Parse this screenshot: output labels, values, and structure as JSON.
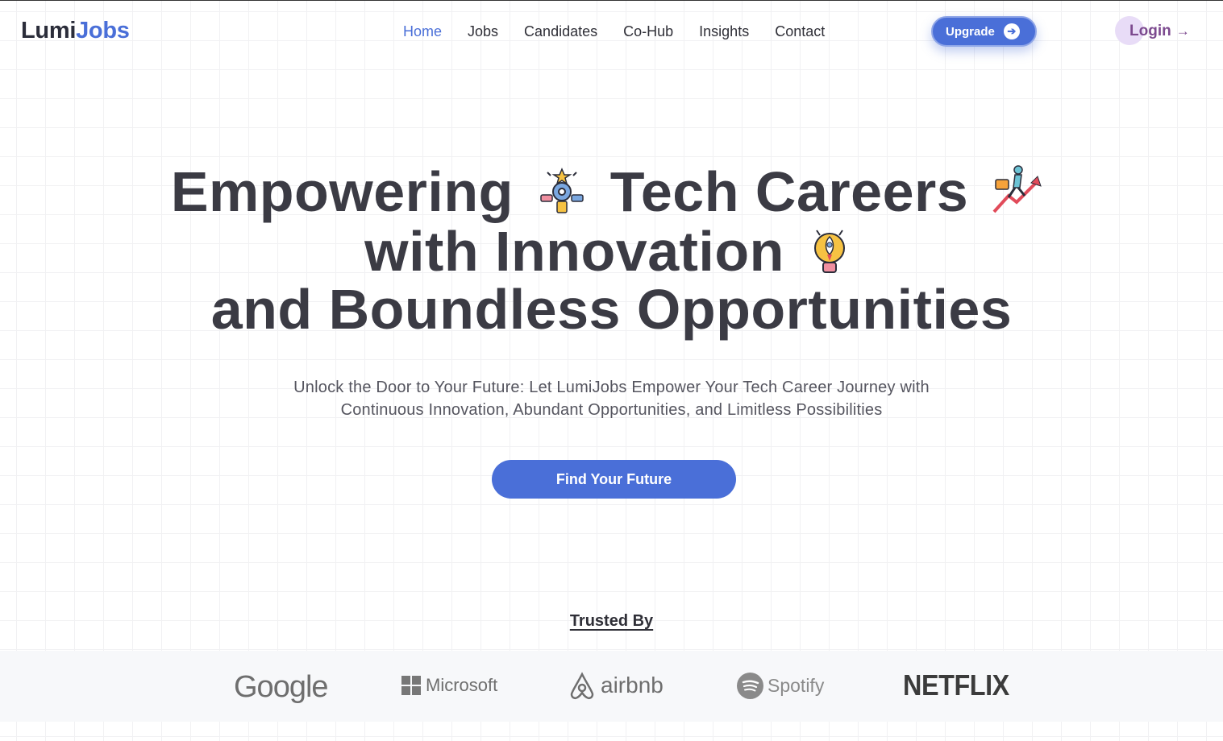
{
  "brand": {
    "part1": "Lumi",
    "part2": "Jobs"
  },
  "nav": {
    "items": [
      {
        "label": "Home",
        "active": true
      },
      {
        "label": "Jobs",
        "active": false
      },
      {
        "label": "Candidates",
        "active": false
      },
      {
        "label": "Co-Hub",
        "active": false
      },
      {
        "label": "Insights",
        "active": false
      },
      {
        "label": "Contact",
        "active": false
      }
    ]
  },
  "header": {
    "upgrade_label": "Upgrade",
    "upgrade_icon": "arrow-right-circle-icon",
    "login_label": "Login",
    "login_arrow": "→"
  },
  "hero": {
    "line1_a": "Empowering",
    "line1_b": "Tech Careers",
    "line2": "with Innovation",
    "line3": "and Boundless Opportunities",
    "emoji_1": "teamwork-gear-icon",
    "emoji_2": "career-growth-runner-icon",
    "emoji_3": "rocket-lightbulb-icon"
  },
  "subtitle": {
    "line1": "Unlock the Door to Your Future: Let LumiJobs Empower Your Tech Career Journey with",
    "line2": "Continuous Innovation, Abundant Opportunities, and Limitless Possibilities"
  },
  "cta_label": "Find Your Future",
  "trusted": {
    "heading": "Trusted By",
    "logos": [
      "Google",
      "Microsoft",
      "airbnb",
      "Spotify",
      "NETFLIX"
    ]
  },
  "colors": {
    "accent": "#4a6fd8",
    "heading": "#3b3b44",
    "login": "#7c4a8f",
    "login_blob": "#e8dcf7"
  }
}
